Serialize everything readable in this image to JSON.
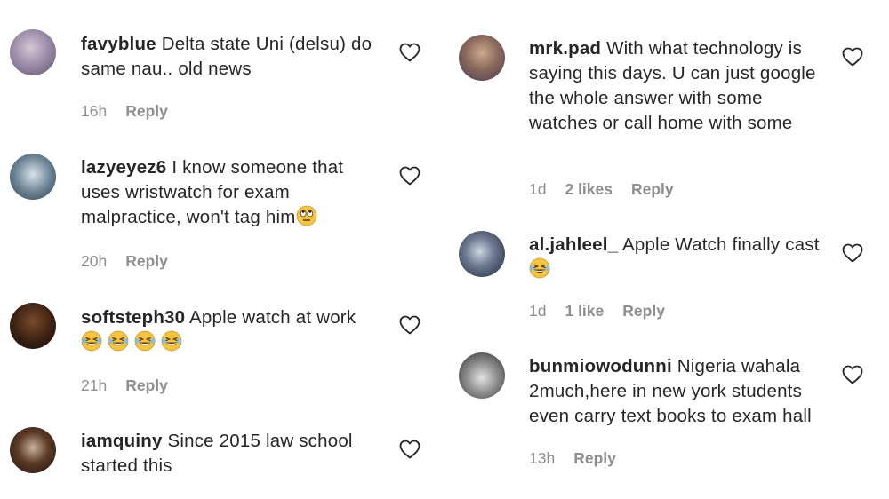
{
  "colors": {
    "text": "#262626",
    "muted": "#8e8e8e",
    "emoji": "#f5c542"
  },
  "left_comments": [
    {
      "username": "favyblue",
      "text": "Delta state Uni (delsu) do same nau.. old news",
      "time": "16h",
      "likes": "",
      "reply": "Reply",
      "emojis": []
    },
    {
      "username": "lazyeyez6",
      "text": "I know someone that uses wristwatch for exam malpractice, won't tag him",
      "time": "20h",
      "likes": "",
      "reply": "Reply",
      "emojis": [
        "face-with-rolling-eyes"
      ]
    },
    {
      "username": "softsteph30",
      "text": "Apple watch at work",
      "time": "21h",
      "likes": "",
      "reply": "Reply",
      "emojis": [
        "grinning-squinting-face",
        "grinning-squinting-face",
        "grinning-squinting-face",
        "grinning-squinting-face"
      ]
    },
    {
      "username": "iamquiny",
      "text": "Since 2015 law school started this",
      "time": "",
      "likes": "",
      "reply": "",
      "emojis": []
    }
  ],
  "right_comments": [
    {
      "username": "mrk.pad",
      "text": "With what technology is saying this days. U can just google the whole answer with some watches or call home with some",
      "time": "1d",
      "likes": "2 likes",
      "reply": "Reply",
      "emojis": []
    },
    {
      "username": "al.jahleel_",
      "text": "Apple Watch finally cast",
      "time": "1d",
      "likes": "1 like",
      "reply": "Reply",
      "emojis": [
        "grinning-squinting-face"
      ]
    },
    {
      "username": "bunmiowodunni",
      "text": "Nigeria wahala 2much,here in new york students even carry text books to exam hall",
      "time": "13h",
      "likes": "",
      "reply": "Reply",
      "emojis": []
    }
  ]
}
